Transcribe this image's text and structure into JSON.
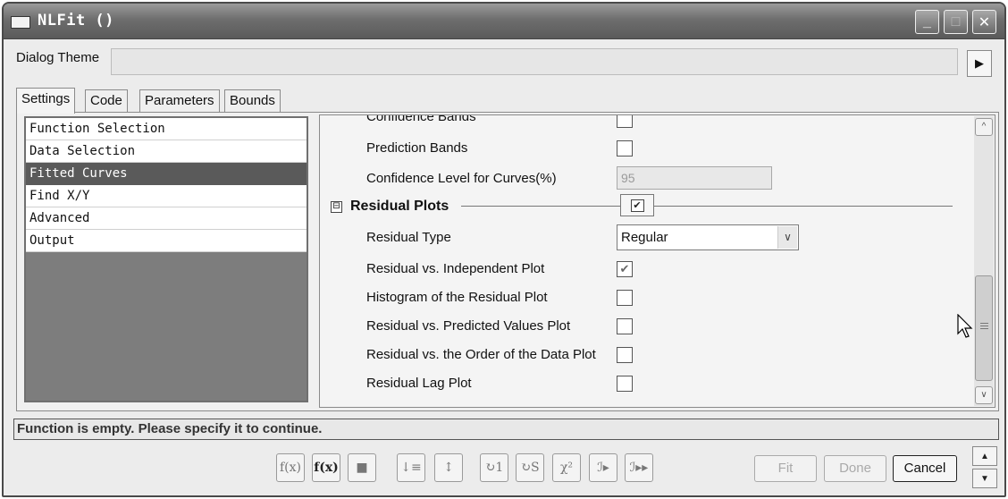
{
  "window": {
    "title": "NLFit ()",
    "controls": {
      "minimize": "_",
      "maximize": "□",
      "close": "✕"
    }
  },
  "dialog_theme": {
    "label": "Dialog Theme",
    "value": "",
    "arrow_icon": "right-triangle-icon"
  },
  "tabs": [
    {
      "label": "Settings",
      "active": true
    },
    {
      "label": "Code",
      "active": false
    },
    {
      "label": "Parameters",
      "active": false
    },
    {
      "label": "Bounds",
      "active": false
    }
  ],
  "nav": {
    "items": [
      {
        "label": "Function Selection",
        "selected": false
      },
      {
        "label": "Data Selection",
        "selected": false
      },
      {
        "label": "Fitted Curves",
        "selected": true
      },
      {
        "label": "Find X/Y",
        "selected": false
      },
      {
        "label": "Advanced",
        "selected": false
      },
      {
        "label": "Output",
        "selected": false
      }
    ]
  },
  "settings": {
    "confidence_bands": {
      "label": "Confidence Bands",
      "checked": false
    },
    "prediction_bands": {
      "label": "Prediction Bands",
      "checked": false
    },
    "confidence_level": {
      "label": "Confidence Level for Curves(%)",
      "value": "95"
    },
    "residual_section": {
      "title": "Residual Plots",
      "toggle_icon": "⊟",
      "checked": true,
      "check_glyph": "✔",
      "residual_type": {
        "label": "Residual Type",
        "value": "Regular",
        "dropdown_icon": "chevron-down-icon"
      },
      "items": [
        {
          "label": "Residual vs. Independent Plot",
          "checked": true,
          "glyph": "✔"
        },
        {
          "label": "Histogram of the Residual Plot",
          "checked": false,
          "glyph": ""
        },
        {
          "label": "Residual vs. Predicted Values Plot",
          "checked": false,
          "glyph": ""
        },
        {
          "label": "Residual vs. the Order of the Data Plot",
          "checked": false,
          "glyph": ""
        },
        {
          "label": "Residual Lag Plot",
          "checked": false,
          "glyph": ""
        }
      ]
    }
  },
  "status": {
    "message": "Function is empty. Please specify it to continue."
  },
  "toolbar": {
    "icons": [
      {
        "name": "function-builder-icon",
        "glyph": "f(x)"
      },
      {
        "name": "function-organizer-icon",
        "glyph": "f(x)"
      },
      {
        "name": "save-icon",
        "glyph": "■"
      },
      {
        "name": "sort-icon",
        "glyph": "↓≡"
      },
      {
        "name": "parameter-initialize-icon",
        "glyph": "↕"
      },
      {
        "name": "one-iteration-icon",
        "glyph": "↻1"
      },
      {
        "name": "simplex-iteration-icon",
        "glyph": "↻S"
      },
      {
        "name": "chi-square-icon",
        "glyph": "χ²"
      },
      {
        "name": "fit-until-converged-icon",
        "glyph": "ℐ▸"
      },
      {
        "name": "fit-iterations-icon",
        "glyph": "ℐ▸▸"
      }
    ]
  },
  "buttons": {
    "fit": {
      "label": "Fit",
      "enabled": false
    },
    "done": {
      "label": "Done",
      "enabled": false
    },
    "cancel": {
      "label": "Cancel",
      "enabled": true
    }
  },
  "spin": {
    "up_icon": "▲",
    "down_icon": "▼"
  }
}
